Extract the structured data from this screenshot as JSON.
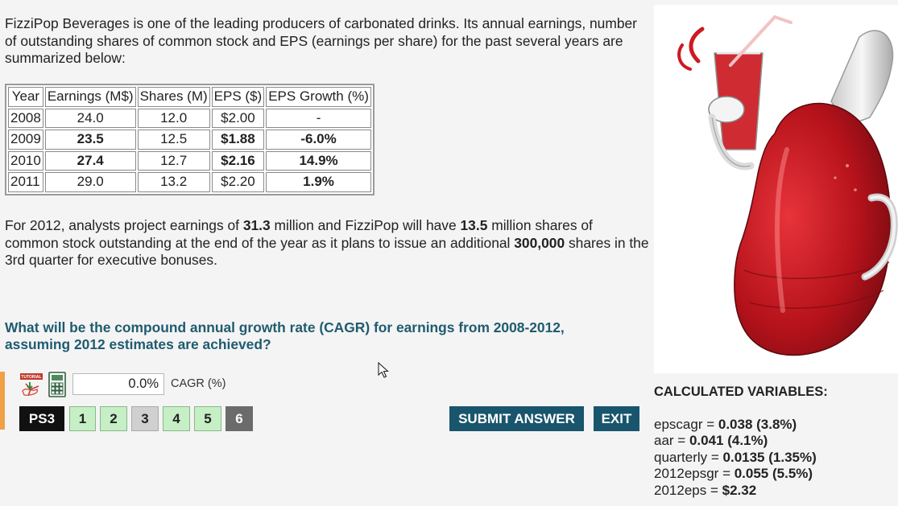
{
  "problem": {
    "intro": "FizziPop Beverages is one of the leading producers of carbonated drinks. Its annual earnings, number of outstanding shares of common stock and EPS (earnings per share) for the past several years are summarized below:",
    "table": {
      "headers": [
        "Year",
        "Earnings (M$)",
        "Shares (M)",
        "EPS ($)",
        "EPS Growth (%)"
      ],
      "rows": [
        {
          "year": "2008",
          "earnings": "24.0",
          "shares": "12.0",
          "eps": "$2.00",
          "growth": "-"
        },
        {
          "year": "2009",
          "earnings": "23.5",
          "shares": "12.5",
          "eps": "$1.88",
          "growth": "-6.0%"
        },
        {
          "year": "2010",
          "earnings": "27.4",
          "shares": "12.7",
          "eps": "$2.16",
          "growth": "14.9%"
        },
        {
          "year": "2011",
          "earnings": "29.0",
          "shares": "13.2",
          "eps": "$2.20",
          "growth": "1.9%"
        }
      ]
    },
    "scenario": {
      "p1": "For 2012, analysts project earnings of ",
      "earnings": "31.3",
      "p2": " million and FizziPop will have ",
      "shares": "13.5",
      "p3": " million shares of common stock outstanding at the end of the year as it plans to issue an additional ",
      "additional": "300,000",
      "p4": " shares in the 3rd quarter for executive bonuses."
    },
    "question": "What will be the compound annual growth rate (CAGR) for earnings from 2008-2012, assuming 2012 estimates are achieved?"
  },
  "answer": {
    "value": "0.0%",
    "unit": "CAGR (%)",
    "tutorial_badge": "TUTORIAL"
  },
  "nav": {
    "set_label": "PS3",
    "pages": [
      "1",
      "2",
      "3",
      "4",
      "5",
      "6"
    ],
    "submit_label": "SUBMIT ANSWER",
    "exit_label": "EXIT"
  },
  "calculated": {
    "title": "CALCULATED VARIABLES:",
    "vars": [
      {
        "name": "epscagr",
        "value": "0.038 (3.8%)"
      },
      {
        "name": "aar",
        "value": "0.041 (4.1%)"
      },
      {
        "name": "quarterly",
        "value": "0.0135 (1.35%)"
      },
      {
        "name": "2012epsgr",
        "value": "0.055 (5.5%)"
      },
      {
        "name": "2012eps",
        "value": "$2.32"
      }
    ]
  },
  "colors": {
    "accent": "#19556c",
    "question": "#1f5b6f",
    "page_done": "#c6efc6",
    "page_current": "#d0d0d0",
    "page_locked": "#6b6b6b",
    "side_bar": "#f0a046"
  },
  "icons": [
    "tutorial-pdf-icon",
    "calculator-icon",
    "mouse-cursor-icon"
  ]
}
